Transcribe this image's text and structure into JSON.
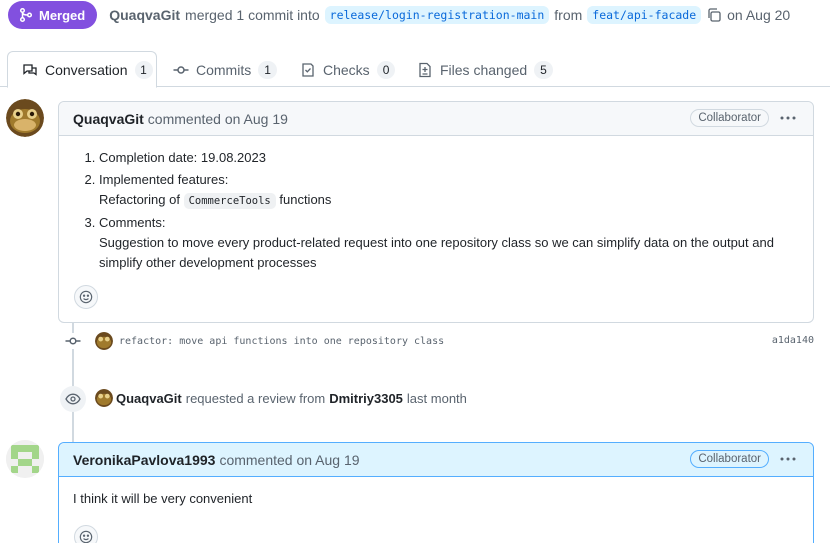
{
  "header": {
    "status_label": "Merged",
    "author": "QuaqvaGit",
    "merged_text": "merged 1 commit into",
    "base_branch": "release/login-registration-main",
    "from_text": "from",
    "head_branch": "feat/api-facade",
    "date_text": "on Aug 20"
  },
  "tabs": [
    {
      "label": "Conversation",
      "count": "1",
      "icon": "comment-discussion-icon"
    },
    {
      "label": "Commits",
      "count": "1",
      "icon": "git-commit-icon"
    },
    {
      "label": "Checks",
      "count": "0",
      "icon": "checklist-icon"
    },
    {
      "label": "Files changed",
      "count": "5",
      "icon": "file-diff-icon"
    }
  ],
  "comment1": {
    "author": "QuaqvaGit",
    "time": "commented on Aug 19",
    "role": "Collaborator",
    "item1": "Completion date: 19.08.2023",
    "item2_title": "Implemented features:",
    "item2_pre": "Refactoring of",
    "item2_code": "CommerceTools",
    "item2_post": "functions",
    "item3_title": "Comments:",
    "item3_text": "Suggestion to move every product-related request into one repository class so we can simplify data on the output and simplify other development processes"
  },
  "commit": {
    "message": "refactor: move api functions into one repository class",
    "sha": "a1da140"
  },
  "review_request": {
    "actor": "QuaqvaGit",
    "text": "requested a review from",
    "reviewer": "Dmitriy3305",
    "time": "last month"
  },
  "comment2": {
    "author": "VeronikaPavlova1993",
    "time": "commented on Aug 19",
    "role": "Collaborator",
    "body": "I think it will be very convenient"
  },
  "colors": {
    "merged": "#8250df",
    "branch_bg": "#ddf4ff",
    "branch_fg": "#0969da",
    "highlight_header": "#ddf4ff",
    "highlight_border": "#54aeff"
  }
}
